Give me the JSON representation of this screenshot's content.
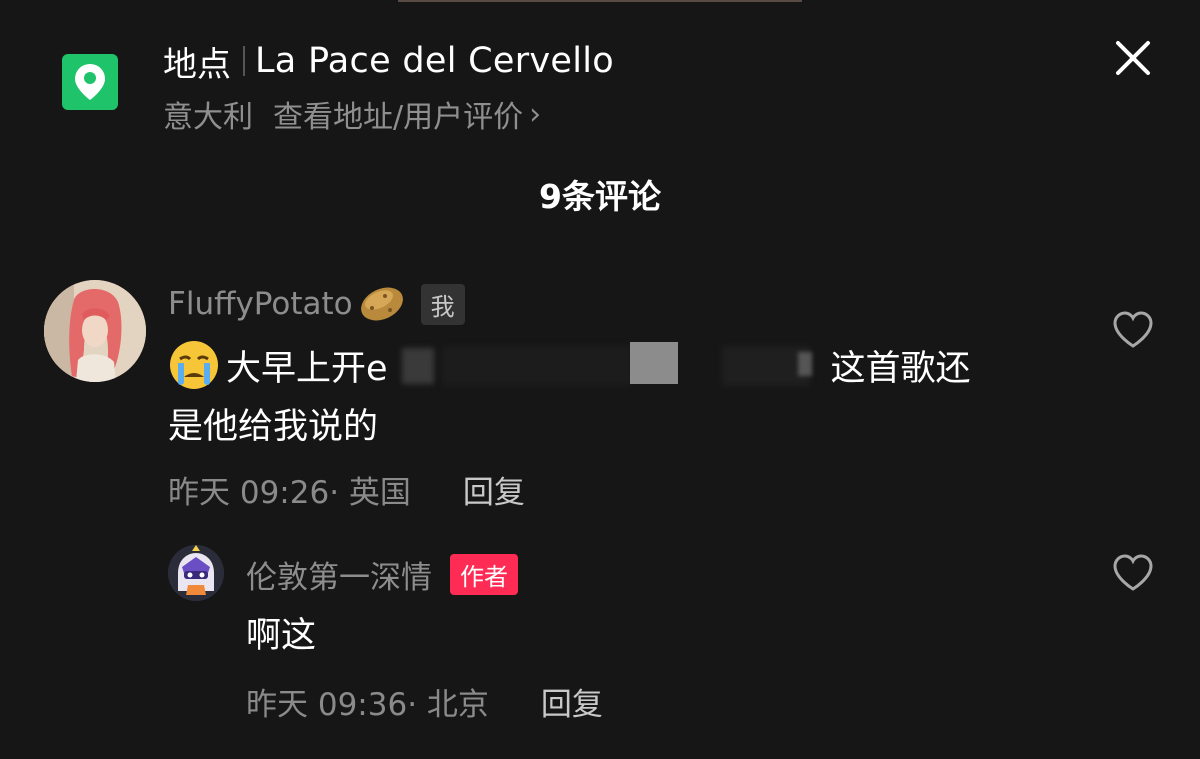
{
  "header": {
    "label": "地点",
    "place_name": "La Pace del Cervello",
    "country": "意大利",
    "link_text": "查看地址/用户评价",
    "chevron": "›",
    "accent_color": "#1fc36a"
  },
  "comments_title": "9条评论",
  "comment": {
    "username": "FluffyPotato",
    "self_badge": "我",
    "text_before_redaction": "大早上开e",
    "text_after_redaction": "这首歌还",
    "text_line2": "是他给我说的",
    "time_location": "昨天 09:26· 英国",
    "reply_label": "回复",
    "liked": false
  },
  "reply": {
    "username": "伦敦第一深情",
    "author_badge": "作者",
    "text": "啊这",
    "time_location": "昨天 09:36· 北京",
    "reply_label": "回复",
    "liked": false,
    "badge_color": "#fe2c55"
  },
  "icons": {
    "location": "location-pin-icon",
    "close": "close-icon",
    "like": "heart-outline-icon",
    "cry_emoji": "crying-emoji-icon",
    "potato_emoji": "potato-emoji-icon"
  }
}
